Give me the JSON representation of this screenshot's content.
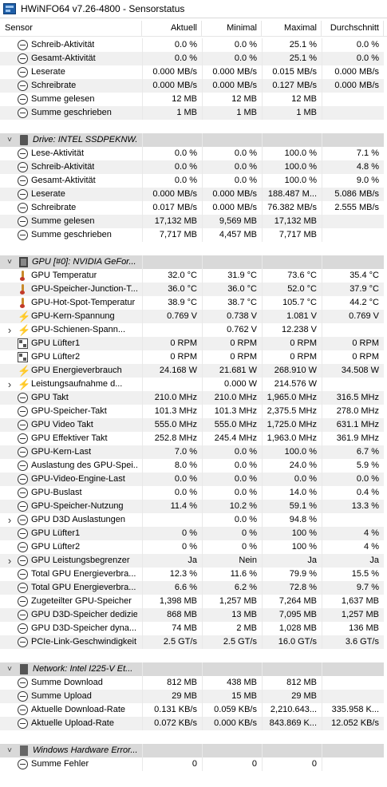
{
  "window": {
    "title": "HWiNFO64 v7.26-4800 - Sensorstatus"
  },
  "columns": [
    "Sensor",
    "Aktuell",
    "Minimal",
    "Maximal",
    "Durchschnitt"
  ],
  "rows": [
    {
      "kind": "item",
      "icon": "clock-icon",
      "name": "Schreib-Aktivität",
      "cur": "0.0 %",
      "min": "0.0 %",
      "max": "25.1 %",
      "avg": "0.0 %"
    },
    {
      "kind": "item",
      "icon": "clock-icon",
      "name": "Gesamt-Aktivität",
      "cur": "0.0 %",
      "min": "0.0 %",
      "max": "25.1 %",
      "avg": "0.0 %"
    },
    {
      "kind": "item",
      "icon": "clock-icon",
      "name": "Leserate",
      "cur": "0.000 MB/s",
      "min": "0.000 MB/s",
      "max": "0.015 MB/s",
      "avg": "0.000 MB/s"
    },
    {
      "kind": "item",
      "icon": "clock-icon",
      "name": "Schreibrate",
      "cur": "0.000 MB/s",
      "min": "0.000 MB/s",
      "max": "0.127 MB/s",
      "avg": "0.000 MB/s"
    },
    {
      "kind": "item",
      "icon": "clock-icon",
      "name": "Summe gelesen",
      "cur": "12 MB",
      "min": "12 MB",
      "max": "12 MB",
      "avg": ""
    },
    {
      "kind": "item",
      "icon": "clock-icon",
      "name": "Summe geschrieben",
      "cur": "1 MB",
      "min": "1 MB",
      "max": "1 MB",
      "avg": ""
    },
    {
      "kind": "spacer"
    },
    {
      "kind": "group",
      "icon": "drive-icon",
      "name": "Drive: INTEL SSDPEKNW..."
    },
    {
      "kind": "item",
      "icon": "clock-icon",
      "name": "Lese-Aktivität",
      "cur": "0.0 %",
      "min": "0.0 %",
      "max": "100.0 %",
      "avg": "7.1 %"
    },
    {
      "kind": "item",
      "icon": "clock-icon",
      "name": "Schreib-Aktivität",
      "cur": "0.0 %",
      "min": "0.0 %",
      "max": "100.0 %",
      "avg": "4.8 %"
    },
    {
      "kind": "item",
      "icon": "clock-icon",
      "name": "Gesamt-Aktivität",
      "cur": "0.0 %",
      "min": "0.0 %",
      "max": "100.0 %",
      "avg": "9.0 %"
    },
    {
      "kind": "item",
      "icon": "clock-icon",
      "name": "Leserate",
      "cur": "0.000 MB/s",
      "min": "0.000 MB/s",
      "max": "188.487 M...",
      "avg": "5.086 MB/s"
    },
    {
      "kind": "item",
      "icon": "clock-icon",
      "name": "Schreibrate",
      "cur": "0.017 MB/s",
      "min": "0.000 MB/s",
      "max": "76.382 MB/s",
      "avg": "2.555 MB/s"
    },
    {
      "kind": "item",
      "icon": "clock-icon",
      "name": "Summe gelesen",
      "cur": "17,132 MB",
      "min": "9,569 MB",
      "max": "17,132 MB",
      "avg": ""
    },
    {
      "kind": "item",
      "icon": "clock-icon",
      "name": "Summe geschrieben",
      "cur": "7,717 MB",
      "min": "4,457 MB",
      "max": "7,717 MB",
      "avg": ""
    },
    {
      "kind": "spacer"
    },
    {
      "kind": "group",
      "icon": "chip-icon",
      "name": "GPU [#0]: NVIDIA GeFor..."
    },
    {
      "kind": "item",
      "icon": "thermometer-icon",
      "name": "GPU Temperatur",
      "cur": "32.0 °C",
      "min": "31.9 °C",
      "max": "73.6 °C",
      "avg": "35.4 °C"
    },
    {
      "kind": "item",
      "icon": "thermometer-icon",
      "name": "GPU-Speicher-Junction-T...",
      "cur": "36.0 °C",
      "min": "36.0 °C",
      "max": "52.0 °C",
      "avg": "37.9 °C"
    },
    {
      "kind": "item",
      "icon": "thermometer-icon",
      "name": "GPU-Hot-Spot-Temperatur",
      "cur": "38.9 °C",
      "min": "38.7 °C",
      "max": "105.7 °C",
      "avg": "44.2 °C"
    },
    {
      "kind": "item",
      "icon": "bolt-icon",
      "name": "GPU-Kern-Spannung",
      "cur": "0.769 V",
      "min": "0.738 V",
      "max": "1.081 V",
      "avg": "0.769 V"
    },
    {
      "kind": "sub",
      "icon": "bolt-icon",
      "name": "GPU-Schienen-Spann...",
      "cur": "",
      "min": "0.762 V",
      "max": "12.238 V",
      "avg": ""
    },
    {
      "kind": "item",
      "icon": "fan-icon",
      "name": "GPU Lüfter1",
      "cur": "0 RPM",
      "min": "0 RPM",
      "max": "0 RPM",
      "avg": "0 RPM"
    },
    {
      "kind": "item",
      "icon": "fan-icon",
      "name": "GPU Lüfter2",
      "cur": "0 RPM",
      "min": "0 RPM",
      "max": "0 RPM",
      "avg": "0 RPM"
    },
    {
      "kind": "item",
      "icon": "bolt-icon",
      "name": "GPU Energieverbrauch",
      "cur": "24.168 W",
      "min": "21.681 W",
      "max": "268.910 W",
      "avg": "34.508 W"
    },
    {
      "kind": "sub",
      "icon": "bolt-icon",
      "name": "Leistungsaufnahme d...",
      "cur": "",
      "min": "0.000 W",
      "max": "214.576 W",
      "avg": ""
    },
    {
      "kind": "item",
      "icon": "clock-icon",
      "name": "GPU Takt",
      "cur": "210.0 MHz",
      "min": "210.0 MHz",
      "max": "1,965.0 MHz",
      "avg": "316.5 MHz"
    },
    {
      "kind": "item",
      "icon": "clock-icon",
      "name": "GPU-Speicher-Takt",
      "cur": "101.3 MHz",
      "min": "101.3 MHz",
      "max": "2,375.5 MHz",
      "avg": "278.0 MHz"
    },
    {
      "kind": "item",
      "icon": "clock-icon",
      "name": "GPU Video Takt",
      "cur": "555.0 MHz",
      "min": "555.0 MHz",
      "max": "1,725.0 MHz",
      "avg": "631.1 MHz"
    },
    {
      "kind": "item",
      "icon": "clock-icon",
      "name": "GPU Effektiver Takt",
      "cur": "252.8 MHz",
      "min": "245.4 MHz",
      "max": "1,963.0 MHz",
      "avg": "361.9 MHz"
    },
    {
      "kind": "item",
      "icon": "clock-icon",
      "name": "GPU-Kern-Last",
      "cur": "7.0 %",
      "min": "0.0 %",
      "max": "100.0 %",
      "avg": "6.7 %"
    },
    {
      "kind": "item",
      "icon": "clock-icon",
      "name": "Auslastung des GPU-Spei...",
      "cur": "8.0 %",
      "min": "0.0 %",
      "max": "24.0 %",
      "avg": "5.9 %"
    },
    {
      "kind": "item",
      "icon": "clock-icon",
      "name": "GPU-Video-Engine-Last",
      "cur": "0.0 %",
      "min": "0.0 %",
      "max": "0.0 %",
      "avg": "0.0 %"
    },
    {
      "kind": "item",
      "icon": "clock-icon",
      "name": "GPU-Buslast",
      "cur": "0.0 %",
      "min": "0.0 %",
      "max": "14.0 %",
      "avg": "0.4 %"
    },
    {
      "kind": "item",
      "icon": "clock-icon",
      "name": "GPU-Speicher-Nutzung",
      "cur": "11.4 %",
      "min": "10.2 %",
      "max": "59.1 %",
      "avg": "13.3 %"
    },
    {
      "kind": "sub",
      "icon": "clock-icon",
      "name": "GPU D3D Auslastungen",
      "cur": "",
      "min": "0.0 %",
      "max": "94.8 %",
      "avg": ""
    },
    {
      "kind": "item",
      "icon": "clock-icon",
      "name": "GPU Lüfter1",
      "cur": "0 %",
      "min": "0 %",
      "max": "100 %",
      "avg": "4 %"
    },
    {
      "kind": "item",
      "icon": "clock-icon",
      "name": "GPU Lüfter2",
      "cur": "0 %",
      "min": "0 %",
      "max": "100 %",
      "avg": "4 %"
    },
    {
      "kind": "sub",
      "icon": "clock-icon",
      "name": "GPU Leistungsbegrenzer",
      "cur": "Ja",
      "min": "Nein",
      "max": "Ja",
      "avg": "Ja"
    },
    {
      "kind": "item",
      "icon": "clock-icon",
      "name": "Total GPU Energieverbra...",
      "cur": "12.3 %",
      "min": "11.6 %",
      "max": "79.9 %",
      "avg": "15.5 %"
    },
    {
      "kind": "item",
      "icon": "clock-icon",
      "name": "Total GPU Energieverbra...",
      "cur": "6.6 %",
      "min": "6.2 %",
      "max": "72.8 %",
      "avg": "9.7 %"
    },
    {
      "kind": "item",
      "icon": "clock-icon",
      "name": "Zugeteilter GPU-Speicher",
      "cur": "1,398 MB",
      "min": "1,257 MB",
      "max": "7,264 MB",
      "avg": "1,637 MB"
    },
    {
      "kind": "item",
      "icon": "clock-icon",
      "name": "GPU D3D-Speicher dediziert",
      "cur": "868 MB",
      "min": "13 MB",
      "max": "7,095 MB",
      "avg": "1,257 MB"
    },
    {
      "kind": "item",
      "icon": "clock-icon",
      "name": "GPU D3D-Speicher dyna...",
      "cur": "74 MB",
      "min": "2 MB",
      "max": "1,028 MB",
      "avg": "136 MB"
    },
    {
      "kind": "item",
      "icon": "clock-icon",
      "name": "PCIe-Link-Geschwindigkeit",
      "cur": "2.5 GT/s",
      "min": "2.5 GT/s",
      "max": "16.0 GT/s",
      "avg": "3.6 GT/s"
    },
    {
      "kind": "spacer"
    },
    {
      "kind": "group",
      "icon": "network-icon",
      "name": "Network: Intel I225-V Et..."
    },
    {
      "kind": "item",
      "icon": "clock-icon",
      "name": "Summe Download",
      "cur": "812 MB",
      "min": "438 MB",
      "max": "812 MB",
      "avg": ""
    },
    {
      "kind": "item",
      "icon": "clock-icon",
      "name": "Summe Upload",
      "cur": "29 MB",
      "min": "15 MB",
      "max": "29 MB",
      "avg": ""
    },
    {
      "kind": "item",
      "icon": "clock-icon",
      "name": "Aktuelle Download-Rate",
      "cur": "0.131 KB/s",
      "min": "0.059 KB/s",
      "max": "2,210.643...",
      "avg": "335.958 K..."
    },
    {
      "kind": "item",
      "icon": "clock-icon",
      "name": "Aktuelle Upload-Rate",
      "cur": "0.072 KB/s",
      "min": "0.000 KB/s",
      "max": "843.869 K...",
      "avg": "12.052 KB/s"
    },
    {
      "kind": "spacer"
    },
    {
      "kind": "group",
      "icon": "error-icon",
      "name": "Windows Hardware Error..."
    },
    {
      "kind": "item",
      "icon": "clock-icon",
      "name": "Summe Fehler",
      "cur": "0",
      "min": "0",
      "max": "0",
      "avg": ""
    }
  ]
}
